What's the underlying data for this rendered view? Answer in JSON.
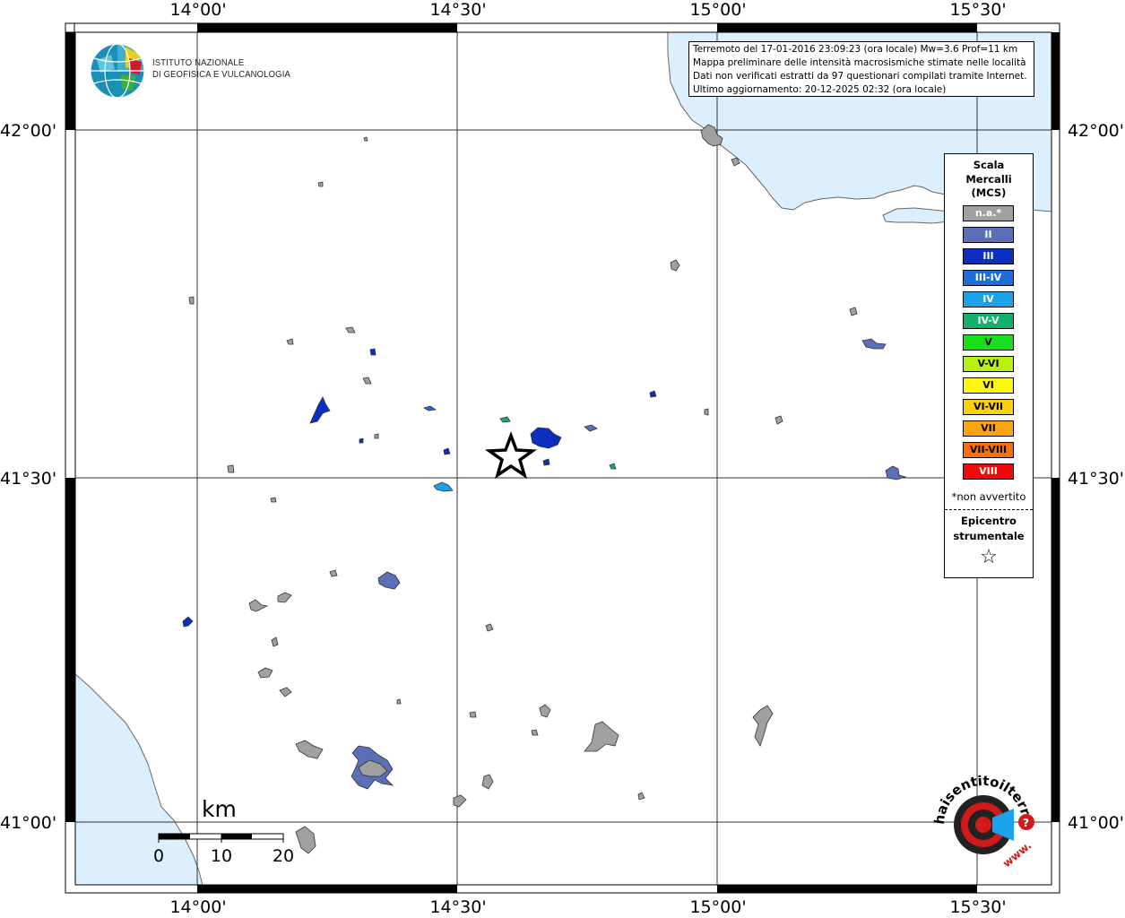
{
  "map": {
    "lon_labels": [
      "14°00'",
      "14°30'",
      "15°00'",
      "15°30'"
    ],
    "lat_labels": [
      "42°00'",
      "41°30'",
      "41°00'"
    ],
    "sea_color": "#dcefff",
    "land_color": "#ffffff",
    "epicenter_marker": "star-outline"
  },
  "logo_ingv": {
    "line1": "ISTITUTO NAZIONALE",
    "line2": "DI GEOFISICA E VULCANOLOGIA"
  },
  "info": {
    "line1": "Terremoto del 17-01-2016 23:09:23 (ora locale) Mw=3.6 Prof=11 km",
    "line2": "Mappa preliminare delle intensità macrosismiche stimate nelle località",
    "line3": "Dati non verificati estratti da 97 questionari compilati tramite Internet.",
    "line4": "Ultimo aggiornamento: 20-12-2025 02:32 (ora locale)"
  },
  "legend": {
    "title_line1": "Scala",
    "title_line2": "Mercalli",
    "title_line3": "(MCS)",
    "items": [
      {
        "label": "n.a.*",
        "color": "#a0a0a0"
      },
      {
        "label": "II",
        "color": "#5a6fb8"
      },
      {
        "label": "III",
        "color": "#0c2fbf"
      },
      {
        "label": "III-IV",
        "color": "#1c6fd8"
      },
      {
        "label": "IV",
        "color": "#1aa3ea"
      },
      {
        "label": "IV-V",
        "color": "#12b06a"
      },
      {
        "label": "V",
        "color": "#19e01c"
      },
      {
        "label": "V-VI",
        "color": "#b6f20d"
      },
      {
        "label": "VI",
        "color": "#fdf70f"
      },
      {
        "label": "VI-VII",
        "color": "#fbd20a"
      },
      {
        "label": "VII",
        "color": "#faa50c"
      },
      {
        "label": "VII-VIII",
        "color": "#f7700a"
      },
      {
        "label": "VIII",
        "color": "#f20a0a"
      }
    ],
    "note": "*non avvertito",
    "epicenter_line1": "Epicentro",
    "epicenter_line2": "strumentale",
    "epicenter_symbol": "☆"
  },
  "scalebar": {
    "unit": "km",
    "labels": [
      "0",
      "10",
      "20"
    ]
  },
  "logo_hst": {
    "text": "haisentitoilterremoto.it",
    "sub": "www."
  }
}
